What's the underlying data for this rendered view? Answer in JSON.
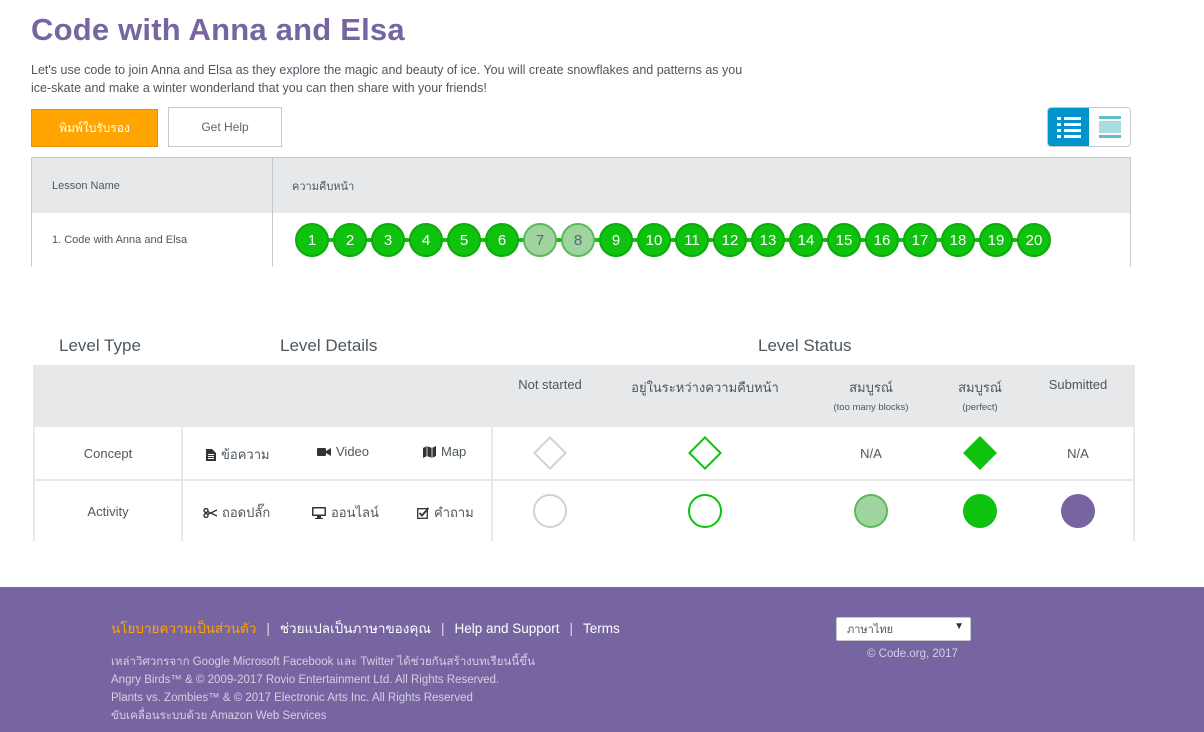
{
  "header": {
    "title": "Code with Anna and Elsa",
    "description": "Let's use code to join Anna and Elsa as they explore the magic and beauty of ice. You will create snowflakes and patterns as you ice-skate and make a winter wonderland that you can then share with your friends!"
  },
  "buttons": {
    "print_label": "พิมพ์ใบรับรอง",
    "help_label": "Get Help"
  },
  "colors": {
    "title_purple": "#7665a0",
    "print_orange": "#ffa400",
    "complete_green": "#0ec20e",
    "attempted_green": "#9fd49f",
    "submitted_purple": "#7665a0",
    "toggle_blue": "#0094ca"
  },
  "progress_table": {
    "col_lesson": "Lesson Name",
    "col_progress": "ความคืบหน้า",
    "lesson_name": "1. Code with Anna and Elsa",
    "levels": [
      {
        "label": "1",
        "status": "perfect"
      },
      {
        "label": "2",
        "status": "perfect"
      },
      {
        "label": "3",
        "status": "perfect"
      },
      {
        "label": "4",
        "status": "perfect"
      },
      {
        "label": "5",
        "status": "perfect"
      },
      {
        "label": "6",
        "status": "perfect"
      },
      {
        "label": "7",
        "status": "attempted"
      },
      {
        "label": "8",
        "status": "attempted"
      },
      {
        "label": "9",
        "status": "perfect"
      },
      {
        "label": "10",
        "status": "perfect"
      },
      {
        "label": "11",
        "status": "perfect"
      },
      {
        "label": "12",
        "status": "perfect"
      },
      {
        "label": "13",
        "status": "perfect"
      },
      {
        "label": "14",
        "status": "perfect"
      },
      {
        "label": "15",
        "status": "perfect"
      },
      {
        "label": "16",
        "status": "perfect"
      },
      {
        "label": "17",
        "status": "perfect"
      },
      {
        "label": "18",
        "status": "perfect"
      },
      {
        "label": "19",
        "status": "perfect"
      },
      {
        "label": "20",
        "status": "perfect"
      }
    ]
  },
  "legend": {
    "heading_type": "Level Type",
    "heading_details": "Level Details",
    "heading_status": "Level Status",
    "status_columns": {
      "not_started": "Not started",
      "in_progress": "อยู่ในระหว่างความคืบหน้า",
      "complete_too_many": "สมบูรณ์",
      "complete_too_many_sub": "(too many blocks)",
      "complete_perfect": "สมบูรณ์",
      "complete_perfect_sub": "(perfect)",
      "submitted": "Submitted"
    },
    "concept": {
      "label": "Concept",
      "detail_text": "ข้อความ",
      "detail_video": "Video",
      "detail_map": "Map",
      "too_many": "N/A",
      "submitted": "N/A"
    },
    "activity": {
      "label": "Activity",
      "detail_unplugged": "ถอดปลั๊ก",
      "detail_online": "ออนไลน์",
      "detail_question": "คำถาม"
    }
  },
  "footer": {
    "privacy": "นโยบายความเป็นส่วนตัว",
    "translate": "ช่วยแปลเป็นภาษาของคุณ",
    "help_support": "Help and Support",
    "terms": "Terms",
    "line1": "เหล่าวิศวกรจาก Google Microsoft Facebook และ Twitter ได้ช่วยกันสร้างบทเรียนนี้ขึ้น",
    "line2": "Angry Birds™ & © 2009-2017 Rovio Entertainment Ltd. All Rights Reserved.",
    "line3": "Plants vs. Zombies™ & © 2017 Electronic Arts Inc. All Rights Reserved",
    "line4": "ขับเคลื่อนระบบด้วย Amazon Web Services",
    "language": "ภาษาไทย",
    "copyright": "© Code.org, 2017"
  }
}
